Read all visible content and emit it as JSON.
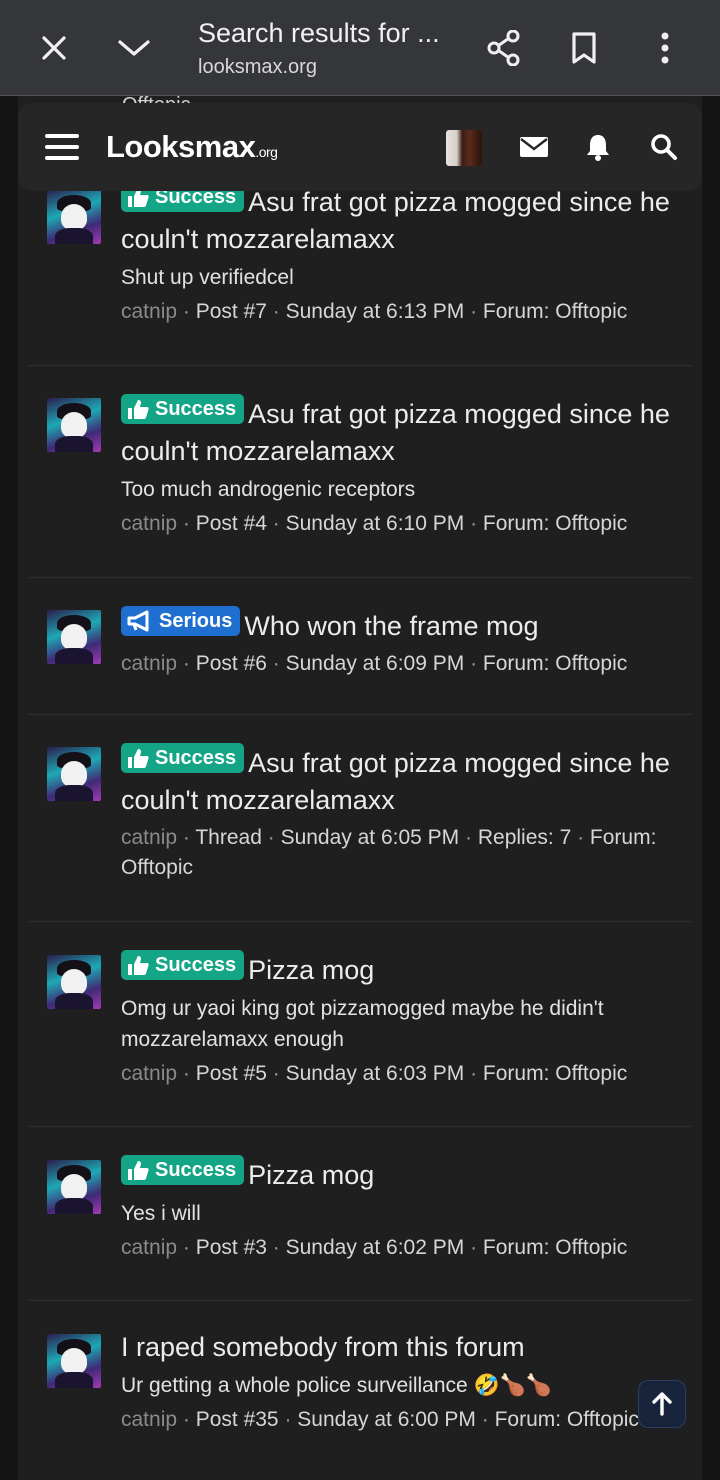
{
  "browser": {
    "title": "Search results for ...",
    "url": "looksmax.org"
  },
  "nav": {
    "logo_main": "Lᴏᴏksmax",
    "logo_suffix": ".org",
    "partial_text": "Offtopic"
  },
  "posts": [
    {
      "badge": "Success",
      "badge_type": "success",
      "title": "Asu frat got pizza mogged since he couln't mozzarelamaxx",
      "snippet": "Shut up verifiedcel",
      "user": "catnip",
      "meta": [
        "Post #7",
        "Sunday at 6:13 PM",
        "Forum: Offtopic"
      ]
    },
    {
      "badge": "Success",
      "badge_type": "success",
      "title": "Asu frat got pizza mogged since he couln't mozzarelamaxx",
      "snippet": "Too much androgenic receptors",
      "user": "catnip",
      "meta": [
        "Post #4",
        "Sunday at 6:10 PM",
        "Forum: Offtopic"
      ]
    },
    {
      "badge": "Serious",
      "badge_type": "serious",
      "title": "Who won the frame mog",
      "snippet": "",
      "user": "catnip",
      "meta": [
        "Post #6",
        "Sunday at 6:09 PM",
        "Forum: Offtopic"
      ]
    },
    {
      "badge": "Success",
      "badge_type": "success",
      "title": "Asu frat got pizza mogged since he couln't mozzarelamaxx",
      "snippet": "",
      "user": "catnip",
      "meta": [
        "Thread",
        "Sunday at 6:05 PM",
        "Replies: 7",
        "Forum: Offtopic"
      ]
    },
    {
      "badge": "Success",
      "badge_type": "success",
      "title": "Pizza mog",
      "snippet": "Omg ur yaoi king got pizzamogged maybe he didin't mozzarelamaxx enough",
      "user": "catnip",
      "meta": [
        "Post #5",
        "Sunday at 6:03 PM",
        "Forum: Offtopic"
      ]
    },
    {
      "badge": "Success",
      "badge_type": "success",
      "title": "Pizza mog",
      "snippet": "Yes i will",
      "user": "catnip",
      "meta": [
        "Post #3",
        "Sunday at 6:02 PM",
        "Forum: Offtopic"
      ]
    },
    {
      "badge": "",
      "badge_type": "",
      "title": "I raped somebody from this forum",
      "snippet": "Ur getting a whole police surveillance 🤣🍗🍗",
      "user": "catnip",
      "meta": [
        "Post #35",
        "Sunday at 6:00 PM",
        "Forum: Offtopic"
      ]
    }
  ],
  "colors": {
    "success": "#13a585",
    "serious": "#1f6fd1",
    "background": "#1f1f1f"
  }
}
